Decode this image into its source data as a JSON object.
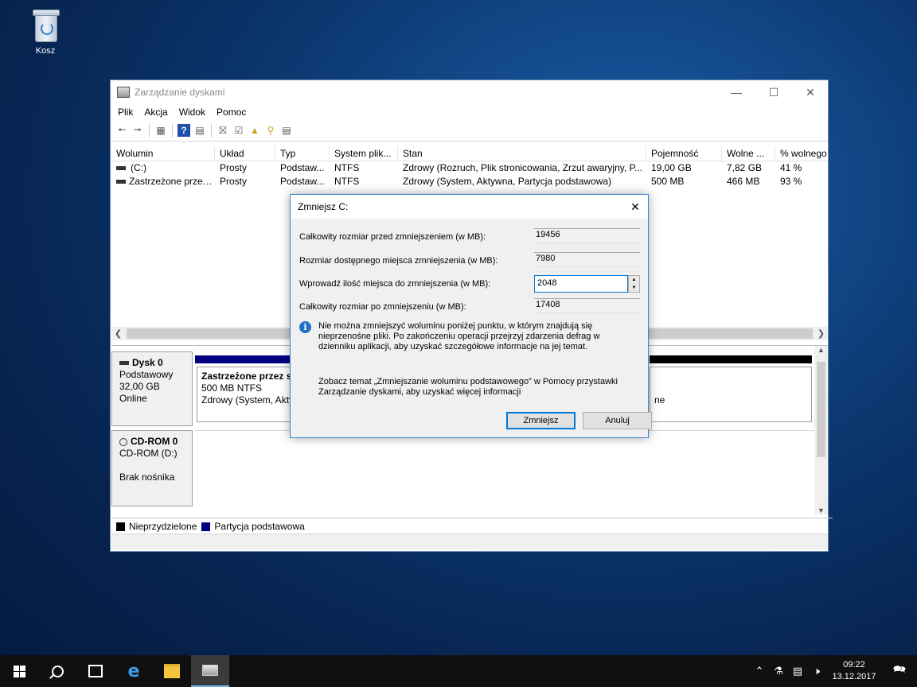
{
  "desktop": {
    "recycle_bin_label": "Kosz"
  },
  "window": {
    "title": "Zarządzanie dyskami",
    "menu": [
      "Plik",
      "Akcja",
      "Widok",
      "Pomoc"
    ]
  },
  "volume_table": {
    "columns": [
      "Wolumin",
      "Układ",
      "Typ",
      "System plik...",
      "Stan",
      "Pojemność",
      "Wolne ...",
      "% wolnego"
    ],
    "rows": [
      [
        "(C:)",
        "Prosty",
        "Podstaw...",
        "NTFS",
        "Zdrowy (Rozruch, Plik stronicowania, Zrzut awaryjny, P...",
        "19,00 GB",
        "7,82 GB",
        "41 %"
      ],
      [
        "Zastrzeżone przez ...",
        "Prosty",
        "Podstaw...",
        "NTFS",
        "Zdrowy (System, Aktywna, Partycja podstawowa)",
        "500 MB",
        "466 MB",
        "93 %"
      ]
    ]
  },
  "disks": {
    "disk0": {
      "name": "Dysk 0",
      "type": "Podstawowy",
      "size": "32,00 GB",
      "status": "Online"
    },
    "partition_reserved": {
      "name": "Zastrzeżone przez sy",
      "size_fs": "500 MB NTFS",
      "status": "Zdrowy (System, Akty"
    },
    "partition_c_tail": "ne",
    "cdrom": {
      "name": "CD-ROM 0",
      "drive": "CD-ROM (D:)",
      "status": "Brak nośnika"
    }
  },
  "legend": {
    "unallocated": "Nieprzydzielone",
    "primary": "Partycja podstawowa"
  },
  "colors": {
    "unallocated": "#000000",
    "primary": "#000080",
    "accent": "#0078d7"
  },
  "dialog": {
    "title": "Zmniejsz C:",
    "total_before_label": "Całkowity rozmiar przed zmniejszeniem (w MB):",
    "total_before_value": "19456",
    "available_label": "Rozmiar dostępnego miejsca zmniejszenia (w MB):",
    "available_value": "7980",
    "enter_label": "Wprowadź ilość miejsca do zmniejszenia (w MB):",
    "enter_value": "2048",
    "total_after_label": "Całkowity rozmiar po zmniejszeniu (w MB):",
    "total_after_value": "17408",
    "info": "Nie można zmniejszyć woluminu poniżej punktu, w którym znajdują się nieprzenośne pliki. Po zakończeniu operacji przejrzyj zdarzenia defrag w dzienniku aplikacji, aby uzyskać szczegółowe informacje na jej temat.",
    "help": "Zobacz temat „Zmniejszanie woluminu podstawowego” w Pomocy przystawki Zarządzanie dyskami, aby uzyskać więcej informacji",
    "shrink_button": "Zmniejsz",
    "cancel_button": "Anuluj"
  },
  "taskbar": {
    "time": "09:22",
    "date": "13.12.2017"
  }
}
